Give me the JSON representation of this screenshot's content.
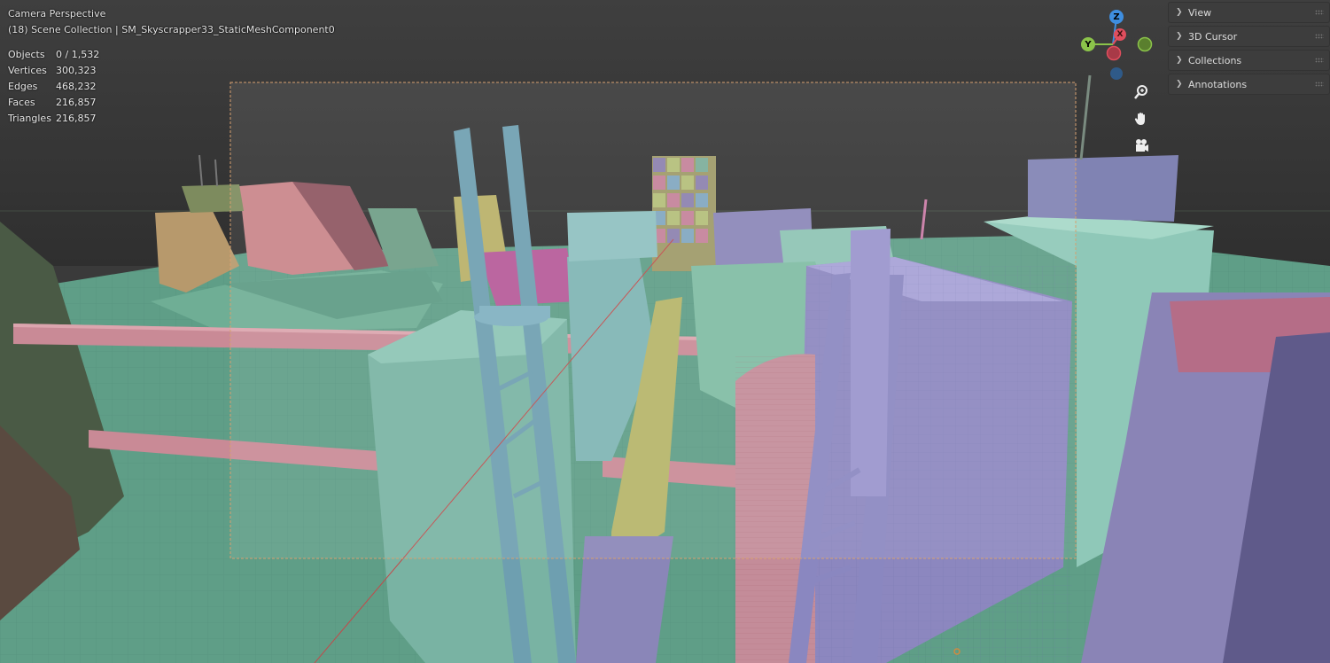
{
  "overlay": {
    "camera_title": "Camera Perspective",
    "scene_info": "(18) Scene Collection | SM_Skyscrapper33_StaticMeshComponent0"
  },
  "stats": [
    {
      "label": "Objects",
      "value": "0 / 1,532"
    },
    {
      "label": "Vertices",
      "value": "300,323"
    },
    {
      "label": "Edges",
      "value": "468,232"
    },
    {
      "label": "Faces",
      "value": "216,857"
    },
    {
      "label": "Triangles",
      "value": "216,857"
    }
  ],
  "gizmo": {
    "z_label": "Z",
    "y_label": "Y",
    "x_label": "X",
    "colors": {
      "x": "#e04e5d",
      "y": "#8bc34a",
      "z": "#3e8ee0"
    }
  },
  "nav_icons": [
    "zoom-icon",
    "hand-pan-icon",
    "camera-view-icon"
  ],
  "sidebar": {
    "panels": [
      {
        "label": "View"
      },
      {
        "label": "3D Cursor"
      },
      {
        "label": "Collections"
      },
      {
        "label": "Annotations"
      }
    ]
  }
}
